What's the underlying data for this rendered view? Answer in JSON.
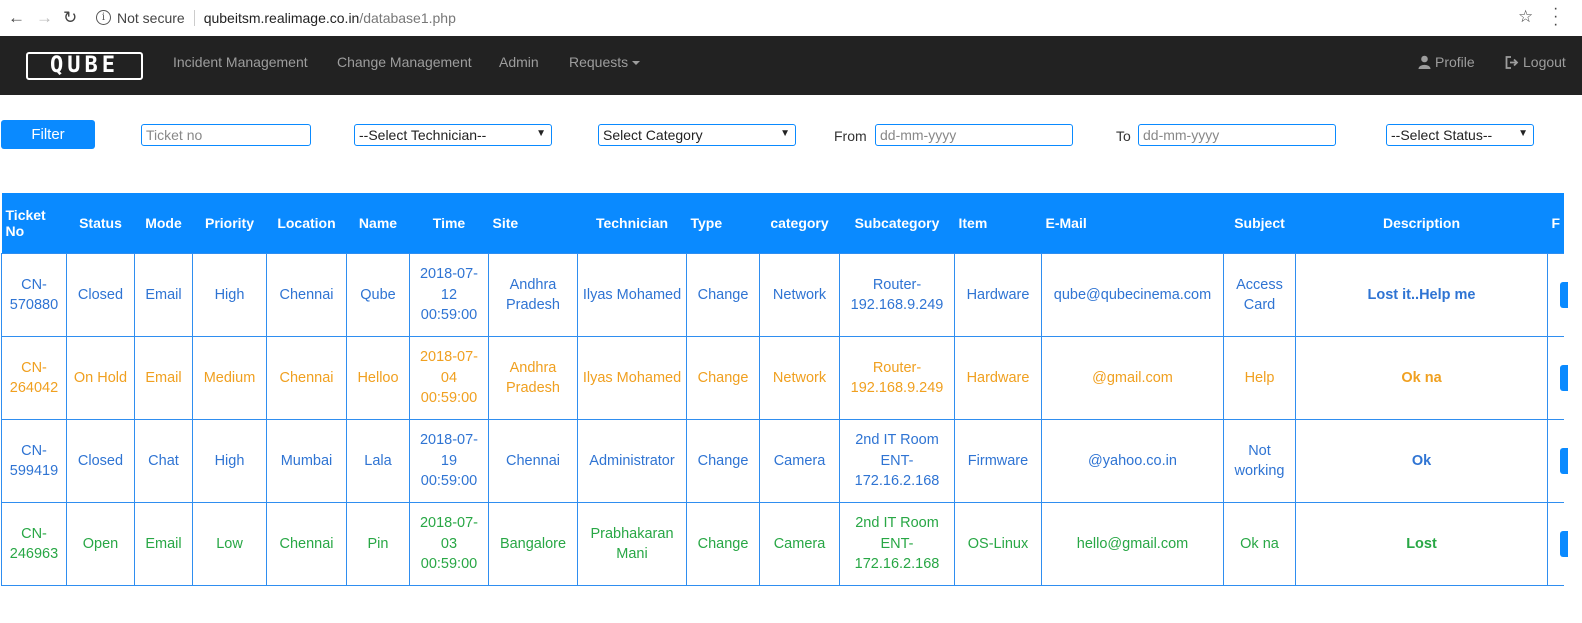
{
  "browser": {
    "security": "Not secure",
    "domain": "qubeitsm.realimage.co.in",
    "path": "/database1.php"
  },
  "navbar": {
    "logo": "QUBE",
    "items": [
      "Incident Management",
      "Change Management",
      "Admin",
      "Requests"
    ],
    "profile": "Profile",
    "logout": "Logout"
  },
  "filters": {
    "button": "Filter",
    "ticket_placeholder": "Ticket no",
    "technician": "--Select Technician--",
    "category": "Select Category",
    "from_label": "From",
    "from_placeholder": "dd-mm-yyyy",
    "to_label": "To",
    "to_placeholder": "dd-mm-yyyy",
    "status": "--Select Status--"
  },
  "table": {
    "columns": [
      "Ticket No",
      "Status",
      "Mode",
      "Priority",
      "Location",
      "Name",
      "Time",
      "Site",
      "Technician",
      "Type",
      "category",
      "Subcategory",
      "Item",
      "E-Mail",
      "Subject",
      "Description",
      "F"
    ],
    "rows": [
      {
        "color": "#2f74d3",
        "cells": [
          "CN-570880",
          "Closed",
          "Email",
          "High",
          "Chennai",
          "Qube",
          "2018-07-12 00:59:00",
          "Andhra Pradesh",
          "Ilyas Mohamed",
          "Change",
          "Network",
          "Router-192.168.9.249",
          "Hardware",
          "qube@qubecinema.com",
          "Access Card",
          "Lost it..Help me"
        ]
      },
      {
        "color": "#f0a020",
        "cells": [
          "CN-264042",
          "On Hold",
          "Email",
          "Medium",
          "Chennai",
          "Helloo",
          "2018-07-04 00:59:00",
          "Andhra Pradesh",
          "Ilyas Mohamed",
          "Change",
          "Network",
          "Router-192.168.9.249",
          "Hardware",
          "@gmail.com",
          "Help",
          "Ok na"
        ]
      },
      {
        "color": "#2f74d3",
        "cells": [
          "CN-599419",
          "Closed",
          "Chat",
          "High",
          "Mumbai",
          "Lala",
          "2018-07-19 00:59:00",
          "Chennai",
          "Administrator",
          "Change",
          "Camera",
          "2nd IT Room ENT-172.16.2.168",
          "Firmware",
          "@yahoo.co.in",
          "Not working",
          "Ok"
        ]
      },
      {
        "color": "#28a745",
        "cells": [
          "CN-246963",
          "Open",
          "Email",
          "Low",
          "Chennai",
          "Pin",
          "2018-07-03 00:59:00",
          "Bangalore",
          "Prabhakaran Mani",
          "Change",
          "Camera",
          "2nd IT Room ENT-172.16.2.168",
          "OS-Linux",
          "hello@gmail.com",
          "Ok na",
          "Lost"
        ]
      }
    ]
  }
}
